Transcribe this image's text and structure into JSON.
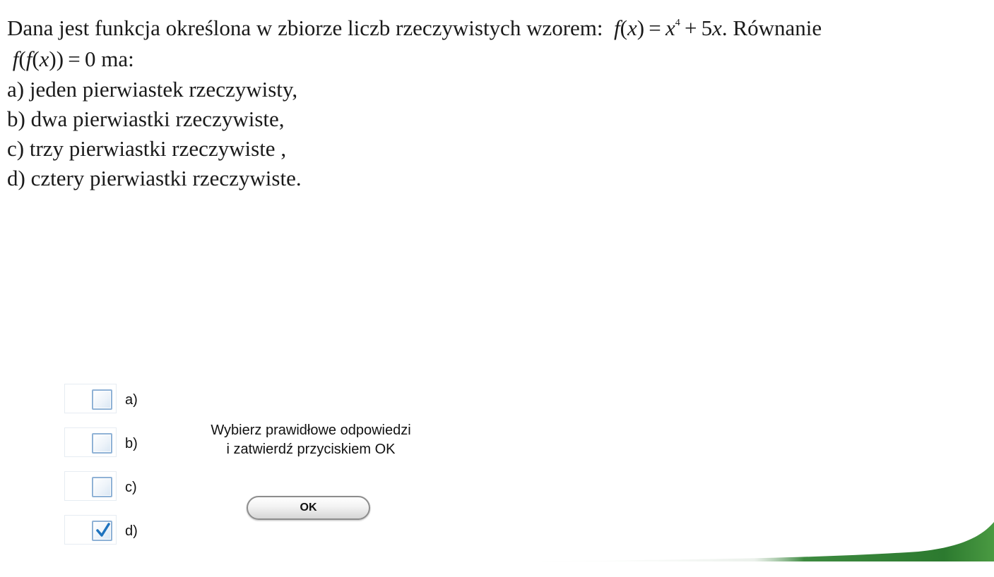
{
  "question": {
    "intro_text": "Dana jest funkcja określona w zbiorze liczb rzeczywistych wzorem:",
    "after_formula_text": ". Równanie",
    "equation_suffix_text": "ma:",
    "options": [
      "a) jeden pierwiastek rzeczywisty,",
      "b) dwa pierwiastki rzeczywiste,",
      "c) trzy pierwiastki rzeczywiste ,",
      "d) cztery pierwiastki rzeczywiste."
    ]
  },
  "answers": [
    {
      "label": "a)",
      "checked": false
    },
    {
      "label": "b)",
      "checked": false
    },
    {
      "label": "c)",
      "checked": false
    },
    {
      "label": "d)",
      "checked": true
    }
  ],
  "instruction": {
    "line1": "Wybierz prawidłowe odpowiedzi",
    "line2": "i zatwierdź przyciskiem OK"
  },
  "ok_button": {
    "label": "OK"
  },
  "colors": {
    "checkbox_border": "#8fb2d6",
    "checkmark": "#1e73be",
    "swoosh_green": "#2e7d32"
  }
}
